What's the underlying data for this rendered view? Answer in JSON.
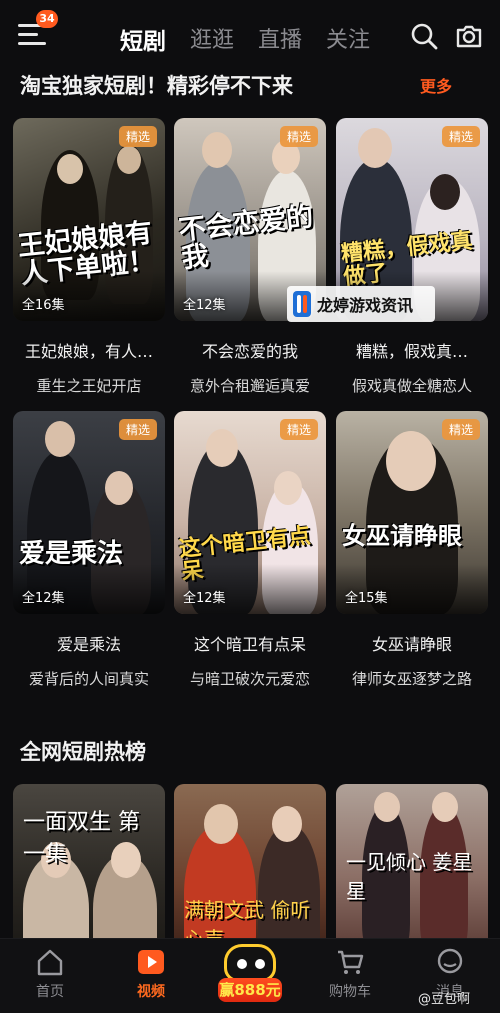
{
  "header": {
    "notification_count": "34",
    "tabs": [
      {
        "label": "短剧",
        "active": true
      },
      {
        "label": "逛逛",
        "active": false
      },
      {
        "label": "直播",
        "active": false
      },
      {
        "label": "关注",
        "active": false
      }
    ],
    "icons": [
      "menu-icon",
      "search-icon",
      "camera-icon"
    ]
  },
  "section": {
    "title": "淘宝独家短剧！精彩停不下来",
    "more_label": "更多"
  },
  "cards": [
    {
      "poster_title": "王妃娘娘有人下单啦！",
      "tag": "精选",
      "episodes": "全16集",
      "title": "王妃娘娘，有人…",
      "subtitle": "重生之王妃开店"
    },
    {
      "poster_title": "不会恋爱的我",
      "tag": "精选",
      "episodes": "全12集",
      "title": "不会恋爱的我",
      "subtitle": "意外合租邂逅真爱"
    },
    {
      "poster_title": "糟糕，假戏真做了",
      "tag": "精选",
      "episodes": "",
      "title": "糟糕，假戏真…",
      "subtitle": "假戏真做全糖恋人"
    },
    {
      "poster_title": "爱是乘法",
      "tag": "精选",
      "episodes": "全12集",
      "title": "爱是乘法",
      "subtitle": "爱背后的人间真实"
    },
    {
      "poster_title": "这个暗卫有点呆",
      "tag": "精选",
      "episodes": "全12集",
      "title": "这个暗卫有点呆",
      "subtitle": "与暗卫破次元爱恋"
    },
    {
      "poster_title": "女巫请睁眼",
      "tag": "精选",
      "episodes": "全15集",
      "title": "女巫请睁眼",
      "subtitle": "律师女巫逐梦之路"
    }
  ],
  "watermark": {
    "text": "龙婷游戏资讯"
  },
  "hot_list": {
    "title": "全网短剧热榜",
    "posters": [
      {
        "poster_title": "一面双生 第一集"
      },
      {
        "poster_title": "满朝文武 偷听心声"
      },
      {
        "poster_title": "一见倾心 姜星星"
      }
    ]
  },
  "bottom_nav": {
    "items": [
      {
        "label": "首页",
        "icon": "home-icon",
        "active": false
      },
      {
        "label": "视频",
        "icon": "play-icon",
        "active": true
      },
      {
        "label": "购物车",
        "icon": "cart-icon",
        "active": false
      },
      {
        "label": "消息",
        "icon": "message-icon",
        "active": false
      }
    ],
    "promo_amount": "赢888元"
  },
  "credit": "@豆包啊",
  "colors": {
    "accent": "#ff5a1f",
    "background": "#0d0d0f",
    "tag": "#ec963c",
    "promo_yellow": "#ffe84a"
  }
}
